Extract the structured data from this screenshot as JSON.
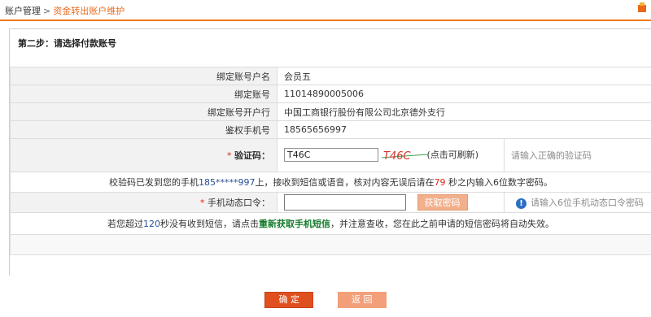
{
  "breadcrumb": {
    "parent": "账户管理",
    "separator": ">",
    "current": "资金转出账户维护"
  },
  "step_title": "第二步：请选择付款账号",
  "form": {
    "bind_name_label": "绑定账号户名",
    "bind_name_value": "会员五",
    "bind_account_label": "绑定账号",
    "bind_account_value": "11014890005006",
    "bind_bank_label": "绑定账号开户行",
    "bind_bank_value": "中国工商银行股份有限公司北京德外支行",
    "auth_phone_label": "鉴权手机号",
    "auth_phone_value": "18565656997",
    "captcha_star": "*",
    "captcha_label": "验证码：",
    "captcha_value": "T46C",
    "captcha_image_text": "T46C",
    "captcha_refresh": "(点击可刷新)",
    "captcha_hint": "请输入正确的验证码",
    "sms_notice": {
      "prefix": "校验码已发到您的手机",
      "phone": "185*****997",
      "middle": "上，接收到短信或语音，核对内容无误后请在",
      "seconds": "79",
      "suffix": " 秒之内输入6位数字密码。"
    },
    "dyn_star": "*",
    "dyn_label": "手机动态口令：",
    "dyn_value": "",
    "get_pwd_button": "获取密码",
    "dyn_hint": "请输入6位手机动态口令密码",
    "resend_notice": {
      "prefix": "若您超过",
      "seconds": "120",
      "middle": "秒没有收到短信，请点击",
      "link": "重新获取手机短信",
      "suffix": "，并注意查收，您在此之前申请的短信密码将自动失效。"
    }
  },
  "buttons": {
    "confirm": "确 定",
    "back": "返 回"
  }
}
